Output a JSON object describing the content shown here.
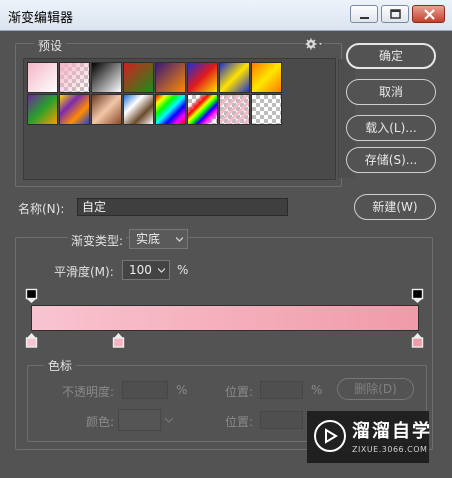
{
  "window": {
    "title": "渐变编辑器",
    "controls": {
      "minimize": "minimize",
      "maximize": "maximize",
      "close": "close"
    }
  },
  "presets": {
    "label": "预设",
    "settings_icon": "gear-icon",
    "swatches": [
      {
        "kind": "fg-bg",
        "colors": [
          "#f4b6c6",
          "#ffffff"
        ]
      },
      {
        "kind": "fg-transparent",
        "colors": [
          "#f4b6c6",
          "transparent"
        ]
      },
      {
        "kind": "black-white",
        "colors": [
          "#000000",
          "#ffffff"
        ]
      },
      {
        "kind": "red-green",
        "colors": [
          "#d21f1f",
          "#1a8f1a"
        ]
      },
      {
        "kind": "violet-orange",
        "colors": [
          "#3a1a7a",
          "#ff8a00"
        ]
      },
      {
        "kind": "blue-red-yellow",
        "colors": [
          "#1f2fd6",
          "#e01a1a",
          "#ffe400"
        ]
      },
      {
        "kind": "blue-yellow-blue",
        "colors": [
          "#1c2fd0",
          "#ffe200",
          "#1c2fd0"
        ]
      },
      {
        "kind": "orange-yellow-orange",
        "colors": [
          "#ff7a00",
          "#ffe600",
          "#ff7a00"
        ]
      },
      {
        "kind": "violet-green-orange",
        "colors": [
          "#6a2a9a",
          "#2aa02a",
          "#ff9a00"
        ]
      },
      {
        "kind": "yellow-violet-orange-blue",
        "colors": [
          "#ffd800",
          "#7a2ab0",
          "#ff8c00",
          "#2040d0"
        ]
      },
      {
        "kind": "copper",
        "colors": [
          "#6b3a22",
          "#f2c7a8",
          "#8a4a2a"
        ]
      },
      {
        "kind": "chrome",
        "colors": [
          "#1f6fd0",
          "#ffffff",
          "#6b4a2a",
          "#ffffff"
        ]
      },
      {
        "kind": "spectrum",
        "colors": [
          "#ff0000",
          "#ffff00",
          "#00ff00",
          "#00ffff",
          "#0000ff",
          "#ff00ff",
          "#ff0000"
        ]
      },
      {
        "kind": "transparent-rainbow",
        "colors": [
          "#ff0000",
          "#ffff00",
          "#00ff00",
          "#0000ff",
          "#ff00ff"
        ]
      },
      {
        "kind": "transparent-stripes",
        "colors": [
          "#f4b6c6",
          "#ffffff"
        ]
      },
      {
        "kind": "transparent",
        "colors": [
          "#cccccc",
          "#ffffff"
        ]
      }
    ]
  },
  "buttons": {
    "ok": "确定",
    "cancel": "取消",
    "load": "载入(L)...",
    "save": "存储(S)...",
    "new": "新建(W)",
    "delete": "删除(D)"
  },
  "name": {
    "label": "名称(N):",
    "value": "自定"
  },
  "gradient_type": {
    "label": "渐变类型:",
    "value": "实底"
  },
  "smoothness": {
    "label": "平滑度(M):",
    "value": "100",
    "unit": "%"
  },
  "gradient": {
    "start_color": "#f8c4d0",
    "end_color": "#f19aa8",
    "opacity_stops": [
      "#000000",
      "#000000"
    ],
    "color_stops": [
      "#f8c4d0",
      "#f6b4c2",
      "#f19aa8"
    ]
  },
  "stops": {
    "label": "色标",
    "opacity_label": "不透明度:",
    "opacity_unit": "%",
    "location_label": "位置:",
    "location_unit": "%",
    "color_label": "颜色:",
    "location2_label": "位置:"
  },
  "watermark": {
    "name": "溜溜自学",
    "url": "ZIXUE.3066.COM"
  }
}
